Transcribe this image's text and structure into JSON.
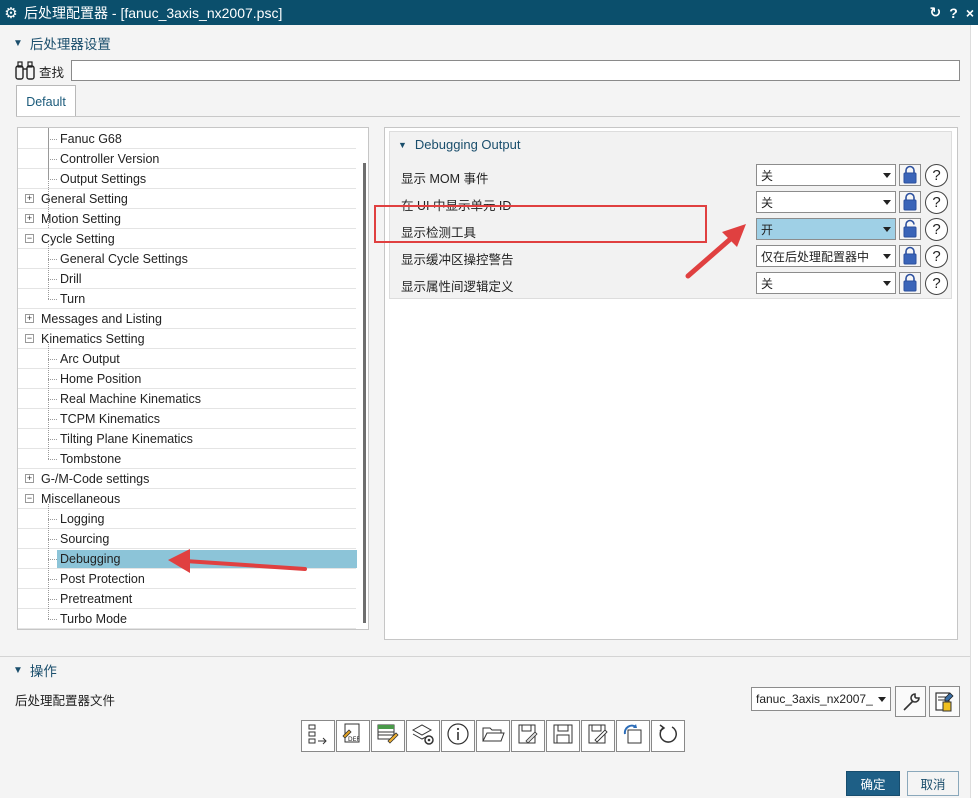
{
  "window": {
    "title": "后处理配置器 - [fanuc_3axis_nx2007.psc]",
    "controls": [
      "↻",
      "?",
      "×"
    ]
  },
  "settings_section": {
    "title": "后处理器设置"
  },
  "find": {
    "label": "查找",
    "value": ""
  },
  "tabs": [
    {
      "label": "Default"
    }
  ],
  "tree": {
    "rows": [
      {
        "label": "Fanuc G68",
        "level": 1,
        "expander": ""
      },
      {
        "label": "Controller Version",
        "level": 1,
        "expander": ""
      },
      {
        "label": "Output Settings",
        "level": 1,
        "expander": ""
      },
      {
        "label": "General Setting",
        "level": 0,
        "expander": "+"
      },
      {
        "label": "Motion Setting",
        "level": 0,
        "expander": "+"
      },
      {
        "label": "Cycle Setting",
        "level": 0,
        "expander": "−"
      },
      {
        "label": "General Cycle Settings",
        "level": 1,
        "expander": ""
      },
      {
        "label": "Drill",
        "level": 1,
        "expander": ""
      },
      {
        "label": "Turn",
        "level": 1,
        "expander": ""
      },
      {
        "label": "Messages and Listing",
        "level": 0,
        "expander": "+"
      },
      {
        "label": "Kinematics Setting",
        "level": 0,
        "expander": "−"
      },
      {
        "label": "Arc Output",
        "level": 1,
        "expander": ""
      },
      {
        "label": "Home Position",
        "level": 1,
        "expander": ""
      },
      {
        "label": "Real Machine Kinematics",
        "level": 1,
        "expander": ""
      },
      {
        "label": "TCPM Kinematics",
        "level": 1,
        "expander": ""
      },
      {
        "label": "Tilting Plane Kinematics",
        "level": 1,
        "expander": ""
      },
      {
        "label": "Tombstone",
        "level": 1,
        "expander": ""
      },
      {
        "label": "G-/M-Code settings",
        "level": 0,
        "expander": "+"
      },
      {
        "label": "Miscellaneous",
        "level": 0,
        "expander": "−"
      },
      {
        "label": "Logging",
        "level": 1,
        "expander": ""
      },
      {
        "label": "Sourcing",
        "level": 1,
        "expander": ""
      },
      {
        "label": "Debugging",
        "level": 1,
        "expander": "",
        "selected": true
      },
      {
        "label": "Post Protection",
        "level": 1,
        "expander": ""
      },
      {
        "label": "Pretreatment",
        "level": 1,
        "expander": ""
      },
      {
        "label": "Turbo Mode",
        "level": 1,
        "expander": ""
      }
    ]
  },
  "debug_group": {
    "title": "Debugging Output",
    "rows": [
      {
        "label": "显示 MOM 事件",
        "value": "关",
        "locked": true,
        "highlight": false
      },
      {
        "label": "在 UI 中显示单元 ID",
        "value": "关",
        "locked": true,
        "highlight": false
      },
      {
        "label": "显示检测工具",
        "value": "开",
        "locked": false,
        "highlight": true
      },
      {
        "label": "显示缓冲区操控警告",
        "value": "仅在后处理配置器中",
        "locked": true,
        "highlight": false
      },
      {
        "label": "显示属性间逻辑定义",
        "value": "关",
        "locked": true,
        "highlight": false
      }
    ]
  },
  "operations": {
    "title": "操作",
    "file_label": "后处理配置器文件",
    "file_value": "fanuc_3axis_nx2007_"
  },
  "toolbar_icons": [
    "export-tree-icon",
    "def-file-icon",
    "edit-grid-icon",
    "layers-settings-icon",
    "info-icon",
    "open-folder-icon",
    "save-as-image-icon",
    "save-icon",
    "save-edit-icon",
    "refresh-copy-icon",
    "undo-icon"
  ],
  "buttons": {
    "ok": "确定",
    "cancel": "取消"
  },
  "colors": {
    "titlebar": "#0b4f6c",
    "accent": "#1a4e6c",
    "selection": "#8cc4d8",
    "highlight_select": "#9fd0e6",
    "annotation": "#e04040",
    "ok_button": "#1e5f86"
  }
}
